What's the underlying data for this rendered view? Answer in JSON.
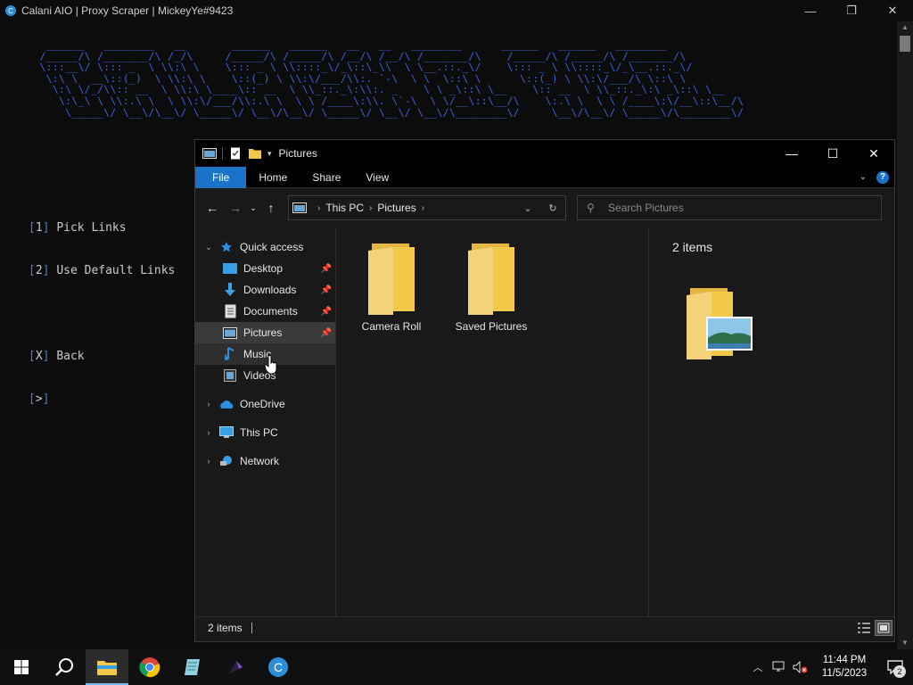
{
  "console": {
    "title": "Calani AIO | Proxy Scraper | MickeyYe#9423",
    "icon_letter": "C",
    "ascii_art": "   ______   ________   __       ______   ______   __   __   ________      ______   ______   ________\n  /_____/\\ /_______/\\ /_/\\     /_____/\\ /_____/\\ /__/\\ /__/\\ /_______/\\    /_____/\\ /_____/\\ /_______/\\\n  \\:::__\\/ \\::: _  \\ \\\\:\\ \\    \\::: _ \\ \\\\::::_\\/_\\::\\_\\\\  \\ \\__.::._\\/    \\::: _ \\ \\\\::::_\\/_\\__.::._\\/\n   \\:\\ \\  __\\::(_)  \\ \\\\:\\ \\    \\::(_) \\ \\\\:\\/___/\\\\:. `-\\  \\ \\  \\::\\ \\      \\::(_) \\ \\\\:\\/___/\\ \\::\\ \\\n    \\:\\ \\/_/\\\\:: __  \\ \\\\:\\ \\____\\:: __  \\ \\\\_::._\\:\\\\:. _    \\ \\ _\\::\\ \\__    \\:: __  \\ \\\\_::._\\:\\ _\\::\\ \\__\n     \\:\\_\\ \\ \\\\:.\\ \\  \\ \\\\:\\/___/\\\\:.\\ \\  \\ \\ /____\\:\\\\. \\`-\\  \\ \\/__\\::\\__/\\    \\:.\\ \\  \\ \\ /____\\:\\/__\\::\\__/\\\n      \\_____\\/ \\__\\/\\__\\/ \\_____\\/ \\__\\/\\__\\/ \\_____\\/ \\__\\/ \\__\\/\\________\\/     \\__\\/\\__\\/ \\_____\\/\\________\\/",
    "menu": [
      {
        "key": "1",
        "label": "Pick Links"
      },
      {
        "key": "2",
        "label": "Use Default Links"
      },
      {
        "key": "X",
        "label": "Back"
      },
      {
        "key": ">",
        "label": ""
      }
    ]
  },
  "explorer": {
    "title": "Pictures",
    "ribbon_tabs": [
      "File",
      "Home",
      "Share",
      "View"
    ],
    "breadcrumb": [
      "This PC",
      "Pictures"
    ],
    "search_placeholder": "Search Pictures",
    "nav": {
      "quick_access": "Quick access",
      "quick_items": [
        {
          "label": "Desktop",
          "icon": "desktop-icon",
          "pinned": true
        },
        {
          "label": "Downloads",
          "icon": "download-icon",
          "pinned": true
        },
        {
          "label": "Documents",
          "icon": "documents-icon",
          "pinned": true
        },
        {
          "label": "Pictures",
          "icon": "pictures-icon",
          "pinned": true
        },
        {
          "label": "Music",
          "icon": "music-icon",
          "pinned": false
        },
        {
          "label": "Videos",
          "icon": "videos-icon",
          "pinned": false
        }
      ],
      "roots": [
        {
          "label": "OneDrive",
          "icon": "onedrive-icon"
        },
        {
          "label": "This PC",
          "icon": "this-pc-icon"
        },
        {
          "label": "Network",
          "icon": "network-icon"
        }
      ]
    },
    "files": [
      {
        "name": "Camera Roll"
      },
      {
        "name": "Saved Pictures"
      }
    ],
    "preview_count": "2 items",
    "status_count": "2 items"
  },
  "taskbar": {
    "time": "11:44 PM",
    "date": "11/5/2023",
    "notification_count": "2",
    "pinned": [
      "start-icon",
      "search-icon",
      "file-explorer-icon",
      "chrome-icon",
      "notepad-icon",
      "app-icon",
      "calani-icon"
    ]
  },
  "colors": {
    "accent": "#1a73c9",
    "ascii": "#3f5fd7",
    "folder": "#f2c84b"
  }
}
